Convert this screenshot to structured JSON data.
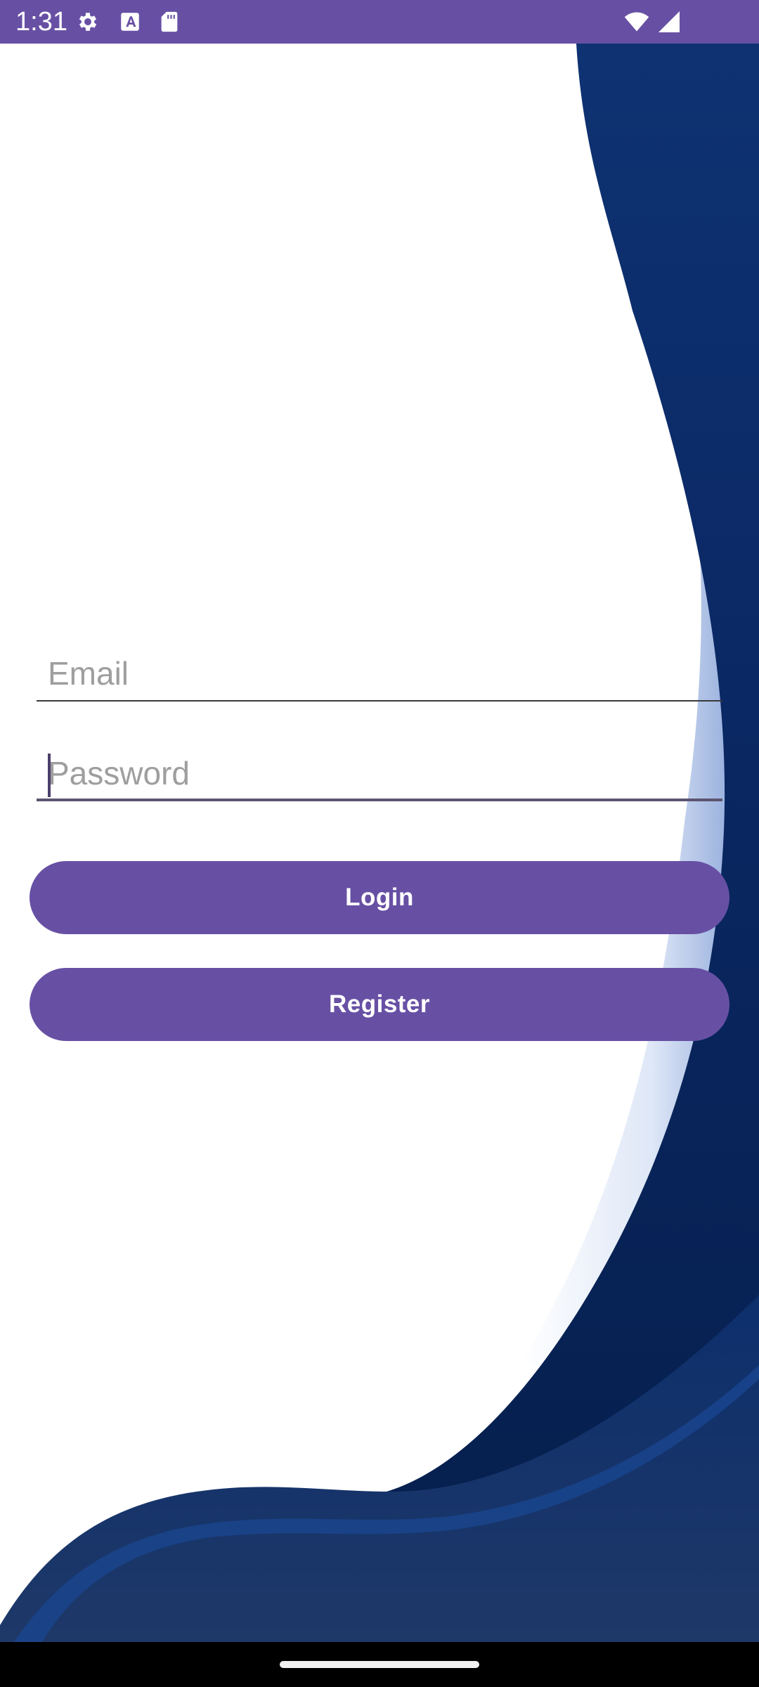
{
  "status_bar": {
    "time": "1:31",
    "background_color": "#6750a4",
    "left_icons": [
      "gear-icon",
      "text-a-icon",
      "sd-card-icon"
    ],
    "right_icons": [
      "wifi-icon",
      "cell-signal-icon"
    ]
  },
  "form": {
    "email": {
      "placeholder": "Email",
      "value": ""
    },
    "password": {
      "placeholder": "Password",
      "value": ""
    }
  },
  "buttons": {
    "login_label": "Login",
    "register_label": "Register",
    "color": "#6750a4"
  },
  "theme": {
    "wave_dark": "#0b2a66",
    "wave_light": "#c7d6f3"
  }
}
